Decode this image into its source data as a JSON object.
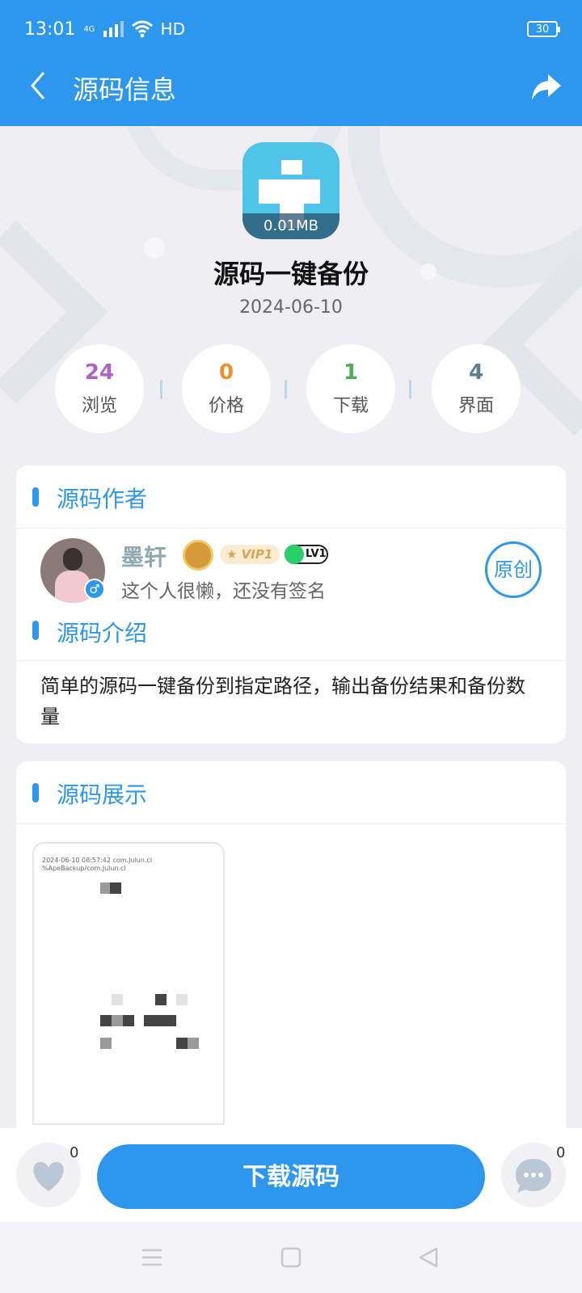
{
  "status_bar": {
    "time": "13:01",
    "network": "4G",
    "hd": "HD",
    "battery": "30"
  },
  "header": {
    "title": "源码信息"
  },
  "app": {
    "size": "0.01MB",
    "name": "源码一键备份",
    "date": "2024-06-10"
  },
  "stats": [
    {
      "value": "24",
      "label": "浏览",
      "color": "#ad63c4"
    },
    {
      "value": "0",
      "label": "价格",
      "color": "#f0902a"
    },
    {
      "value": "1",
      "label": "下载",
      "color": "#4caf50"
    },
    {
      "value": "4",
      "label": "界面",
      "color": "#5f7f8f"
    }
  ],
  "author_section": {
    "title": "源码作者",
    "name": "墨轩",
    "vip": "VIP1",
    "level": "LV1",
    "signature": "这个人很懒，还没有签名",
    "original_badge": "原创"
  },
  "intro_section": {
    "title": "源码介绍",
    "text": "简单的源码一键备份到指定路径，输出备份结果和备份数量"
  },
  "showcase_section": {
    "title": "源码展示",
    "screenshot_lines": [
      "2024-06-10 08:57:42 com.Julun.cl",
      "%ApeBackup/com.Julun.cl"
    ]
  },
  "bottom_bar": {
    "like_count": "0",
    "comment_count": "0",
    "download_label": "下载源码"
  },
  "colors": {
    "primary": "#2d97ee",
    "background": "#efeff3"
  }
}
